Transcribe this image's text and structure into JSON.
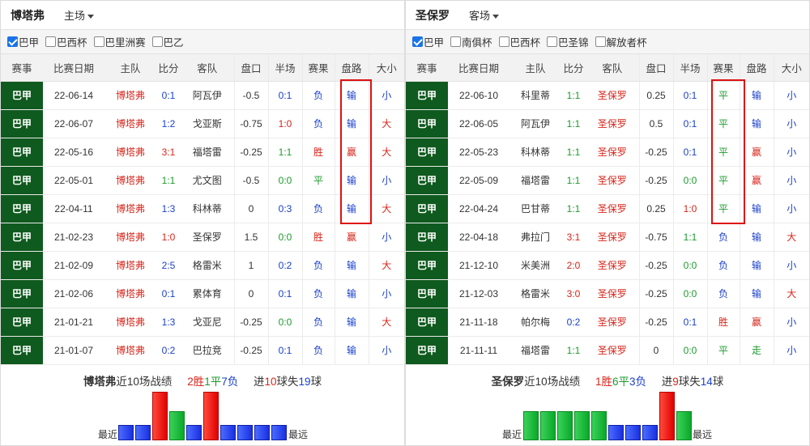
{
  "headers": [
    "赛事",
    "比赛日期",
    "主队",
    "比分",
    "客队",
    "盘口",
    "半场",
    "赛果",
    "盘路",
    "大小"
  ],
  "colors": {
    "win": "#e00000",
    "draw": "#1c9b2d",
    "loss": "#1a3fcc",
    "league_bg": "#0f5a1e",
    "highlight_box": "#e01010"
  },
  "left": {
    "team": "博塔弗",
    "venue": "主场",
    "filters": [
      {
        "label": "巴甲",
        "checked": true
      },
      {
        "label": "巴西杯",
        "checked": false
      },
      {
        "label": "巴里洲赛",
        "checked": false
      },
      {
        "label": "巴乙",
        "checked": false
      }
    ],
    "rows": [
      {
        "league": "巴甲",
        "date": "22-06-14",
        "home": "博塔弗",
        "score": "0:1",
        "away": "阿瓦伊",
        "handicap": "-0.5",
        "half": "0:1",
        "result": "负",
        "pan": "输",
        "ou": "小"
      },
      {
        "league": "巴甲",
        "date": "22-06-07",
        "home": "博塔弗",
        "score": "1:2",
        "away": "戈亚斯",
        "handicap": "-0.75",
        "half": "1:0",
        "result": "负",
        "pan": "输",
        "ou": "大"
      },
      {
        "league": "巴甲",
        "date": "22-05-16",
        "home": "博塔弗",
        "score": "3:1",
        "away": "福塔雷",
        "handicap": "-0.25",
        "half": "1:1",
        "result": "胜",
        "pan": "赢",
        "ou": "大"
      },
      {
        "league": "巴甲",
        "date": "22-05-01",
        "home": "博塔弗",
        "score": "1:1",
        "away": "尤文图",
        "handicap": "-0.5",
        "half": "0:0",
        "result": "平",
        "pan": "输",
        "ou": "小"
      },
      {
        "league": "巴甲",
        "date": "22-04-11",
        "home": "博塔弗",
        "score": "1:3",
        "away": "科林蒂",
        "handicap": "0",
        "half": "0:3",
        "result": "负",
        "pan": "输",
        "ou": "大"
      },
      {
        "league": "巴甲",
        "date": "21-02-23",
        "home": "博塔弗",
        "score": "1:0",
        "away": "圣保罗",
        "handicap": "1.5",
        "half": "0:0",
        "result": "胜",
        "pan": "赢",
        "ou": "小"
      },
      {
        "league": "巴甲",
        "date": "21-02-09",
        "home": "博塔弗",
        "score": "2:5",
        "away": "格雷米",
        "handicap": "1",
        "half": "0:2",
        "result": "负",
        "pan": "输",
        "ou": "大"
      },
      {
        "league": "巴甲",
        "date": "21-02-06",
        "home": "博塔弗",
        "score": "0:1",
        "away": "累体育",
        "handicap": "0",
        "half": "0:1",
        "result": "负",
        "pan": "输",
        "ou": "小"
      },
      {
        "league": "巴甲",
        "date": "21-01-21",
        "home": "博塔弗",
        "score": "1:3",
        "away": "戈亚尼",
        "handicap": "-0.25",
        "half": "0:0",
        "result": "负",
        "pan": "输",
        "ou": "大"
      },
      {
        "league": "巴甲",
        "date": "21-01-07",
        "home": "博塔弗",
        "score": "0:2",
        "away": "巴拉竞",
        "handicap": "-0.25",
        "half": "0:1",
        "result": "负",
        "pan": "输",
        "ou": "小"
      }
    ],
    "summary": {
      "prefix": "博塔弗",
      "text": "近10场战绩",
      "wins": "2胜",
      "draws": "1平",
      "losses": "7负",
      "g1": "进",
      "gf": "10",
      "g2": "球失",
      "ga": "19",
      "g3": "球"
    },
    "form": [
      "loss",
      "loss",
      "win",
      "draw",
      "loss",
      "win",
      "loss",
      "loss",
      "loss",
      "loss"
    ],
    "near": "最近",
    "far": "最远"
  },
  "right": {
    "team": "圣保罗",
    "venue": "客场",
    "filters": [
      {
        "label": "巴甲",
        "checked": true
      },
      {
        "label": "南俱杯",
        "checked": false
      },
      {
        "label": "巴西杯",
        "checked": false
      },
      {
        "label": "巴圣锦",
        "checked": false
      },
      {
        "label": "解放者杯",
        "checked": false
      }
    ],
    "rows": [
      {
        "league": "巴甲",
        "date": "22-06-10",
        "home": "科里蒂",
        "score": "1:1",
        "away": "圣保罗",
        "handicap": "0.25",
        "half": "0:1",
        "result": "平",
        "pan": "输",
        "ou": "小"
      },
      {
        "league": "巴甲",
        "date": "22-06-05",
        "home": "阿瓦伊",
        "score": "1:1",
        "away": "圣保罗",
        "handicap": "0.5",
        "half": "0:1",
        "result": "平",
        "pan": "输",
        "ou": "小"
      },
      {
        "league": "巴甲",
        "date": "22-05-23",
        "home": "科林蒂",
        "score": "1:1",
        "away": "圣保罗",
        "handicap": "-0.25",
        "half": "0:1",
        "result": "平",
        "pan": "赢",
        "ou": "小"
      },
      {
        "league": "巴甲",
        "date": "22-05-09",
        "home": "福塔雷",
        "score": "1:1",
        "away": "圣保罗",
        "handicap": "-0.25",
        "half": "0:0",
        "result": "平",
        "pan": "赢",
        "ou": "小"
      },
      {
        "league": "巴甲",
        "date": "22-04-24",
        "home": "巴甘蒂",
        "score": "1:1",
        "away": "圣保罗",
        "handicap": "0.25",
        "half": "1:0",
        "result": "平",
        "pan": "输",
        "ou": "小"
      },
      {
        "league": "巴甲",
        "date": "22-04-18",
        "home": "弗拉门",
        "score": "3:1",
        "away": "圣保罗",
        "handicap": "-0.75",
        "half": "1:1",
        "result": "负",
        "pan": "输",
        "ou": "大"
      },
      {
        "league": "巴甲",
        "date": "21-12-10",
        "home": "米美洲",
        "score": "2:0",
        "away": "圣保罗",
        "handicap": "-0.25",
        "half": "0:0",
        "result": "负",
        "pan": "输",
        "ou": "小"
      },
      {
        "league": "巴甲",
        "date": "21-12-03",
        "home": "格雷米",
        "score": "3:0",
        "away": "圣保罗",
        "handicap": "-0.25",
        "half": "0:0",
        "result": "负",
        "pan": "输",
        "ou": "大"
      },
      {
        "league": "巴甲",
        "date": "21-11-18",
        "home": "帕尔梅",
        "score": "0:2",
        "away": "圣保罗",
        "handicap": "-0.25",
        "half": "0:1",
        "result": "胜",
        "pan": "赢",
        "ou": "小"
      },
      {
        "league": "巴甲",
        "date": "21-11-11",
        "home": "福塔雷",
        "score": "1:1",
        "away": "圣保罗",
        "handicap": "0",
        "half": "0:0",
        "result": "平",
        "pan": "走",
        "ou": "小"
      }
    ],
    "summary": {
      "prefix": "圣保罗",
      "text": "近10场战绩",
      "wins": "1胜",
      "draws": "6平",
      "losses": "3负",
      "g1": "进",
      "gf": "9",
      "g2": "球失",
      "ga": "14",
      "g3": "球"
    },
    "form": [
      "draw",
      "draw",
      "draw",
      "draw",
      "draw",
      "loss",
      "loss",
      "loss",
      "win",
      "draw"
    ],
    "near": "最近",
    "far": "最远"
  }
}
